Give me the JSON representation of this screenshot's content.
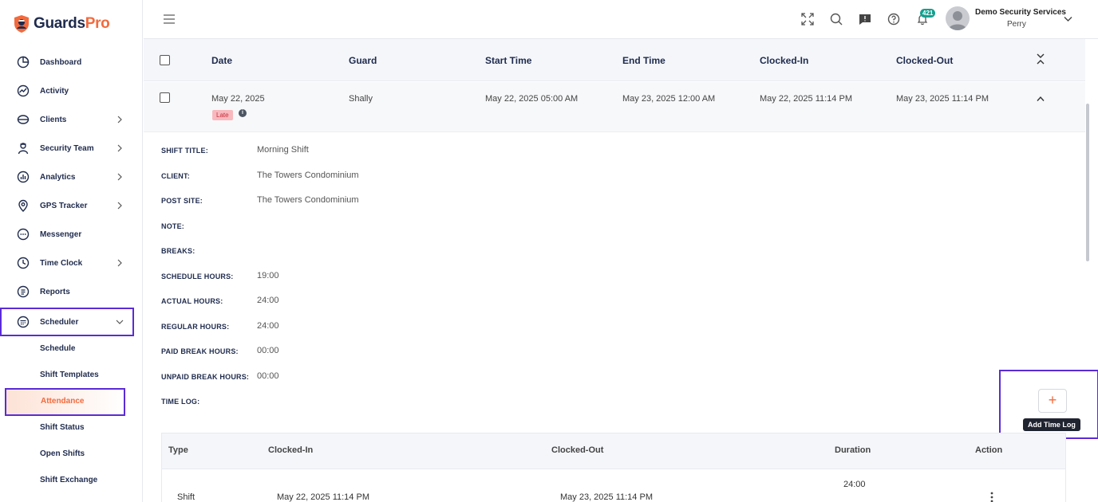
{
  "brand": {
    "name_part1": "Guards",
    "name_part2": "Pro",
    "accent": "#f26a3d",
    "navy": "#1f2b4d"
  },
  "sidebar": {
    "items": [
      {
        "label": "Dashboard",
        "icon": "dashboard-icon",
        "has_chevron": false
      },
      {
        "label": "Activity",
        "icon": "activity-icon",
        "has_chevron": false
      },
      {
        "label": "Clients",
        "icon": "clients-icon",
        "has_chevron": true
      },
      {
        "label": "Security Team",
        "icon": "security-team-icon",
        "has_chevron": true
      },
      {
        "label": "Analytics",
        "icon": "analytics-icon",
        "has_chevron": true
      },
      {
        "label": "GPS Tracker",
        "icon": "location-pin-icon",
        "has_chevron": true
      },
      {
        "label": "Messenger",
        "icon": "chat-icon",
        "has_chevron": false
      },
      {
        "label": "Time Clock",
        "icon": "clock-icon",
        "has_chevron": true
      },
      {
        "label": "Reports",
        "icon": "reports-icon",
        "has_chevron": false
      },
      {
        "label": "Scheduler",
        "icon": "calendar-icon",
        "has_chevron": true
      }
    ],
    "scheduler_sub": [
      {
        "label": "Schedule"
      },
      {
        "label": "Shift Templates"
      },
      {
        "label": "Attendance"
      },
      {
        "label": "Shift Status"
      },
      {
        "label": "Open Shifts"
      },
      {
        "label": "Shift Exchange"
      }
    ]
  },
  "header": {
    "notification_count": "421",
    "company": "Demo Security Services",
    "user": "Perry"
  },
  "table": {
    "columns": [
      "Date",
      "Guard",
      "Start Time",
      "End Time",
      "Clocked-In",
      "Clocked-Out"
    ],
    "row": {
      "date": "May 22, 2025",
      "guard": "Shally",
      "start": "May 22, 2025 05:00 AM",
      "end": "May 23, 2025 12:00 AM",
      "clocked_in": "May 22, 2025 11:14 PM",
      "clocked_out": "May 23, 2025 11:14 PM",
      "status": "Late"
    }
  },
  "details": {
    "shift_title_label": "SHIFT TITLE:",
    "shift_title": "Morning Shift",
    "client_label": "CLIENT:",
    "client": "The Towers Condominium",
    "post_site_label": "POST SITE:",
    "post_site": "The Towers Condominium",
    "note_label": "NOTE:",
    "breaks_label": "BREAKS:",
    "schedule_hours_label": "SCHEDULE HOURS:",
    "schedule_hours": "19:00",
    "actual_hours_label": "ACTUAL HOURS:",
    "actual_hours": "24:00",
    "regular_hours_label": "REGULAR HOURS:",
    "regular_hours": "24:00",
    "paid_break_label": "PAID BREAK HOURS:",
    "paid_break": "00:00",
    "unpaid_break_label": "UNPAID BREAK HOURS:",
    "unpaid_break": "00:00",
    "time_log_label": "TIME LOG:"
  },
  "time_log": {
    "add_button": "+",
    "tooltip": "Add Time Log",
    "columns": {
      "type": "Type",
      "clocked_in": "Clocked-In",
      "clocked_out": "Clocked-Out",
      "duration": "Duration",
      "action": "Action"
    },
    "row": {
      "type": "Shift",
      "clocked_in": "May 22, 2025 11:14 PM",
      "clocked_out": "May 23, 2025 11:14 PM",
      "duration": "24:00"
    }
  }
}
